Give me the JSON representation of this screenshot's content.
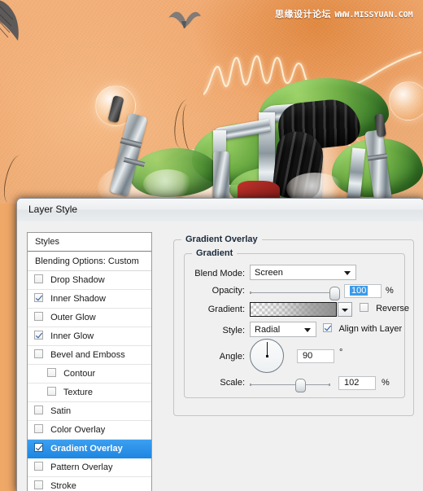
{
  "artwork": {
    "watermark_cn": "思缘设计论坛",
    "watermark_url": "WWW.MISSYUAN.COM",
    "background_color": "#f0a868"
  },
  "dialog": {
    "title": "Layer Style",
    "accent_color": "#1f87e2",
    "styles_list": [
      {
        "label": "Styles",
        "type": "header",
        "checkbox": false,
        "checked": false,
        "selected": false,
        "indent": false
      },
      {
        "label": "Blending Options: Custom",
        "type": "header2",
        "checkbox": false,
        "checked": false,
        "selected": false,
        "indent": false
      },
      {
        "label": "Drop Shadow",
        "type": "item",
        "checkbox": true,
        "checked": false,
        "selected": false,
        "indent": false
      },
      {
        "label": "Inner Shadow",
        "type": "item",
        "checkbox": true,
        "checked": true,
        "selected": false,
        "indent": false
      },
      {
        "label": "Outer Glow",
        "type": "item",
        "checkbox": true,
        "checked": false,
        "selected": false,
        "indent": false
      },
      {
        "label": "Inner Glow",
        "type": "item",
        "checkbox": true,
        "checked": true,
        "selected": false,
        "indent": false
      },
      {
        "label": "Bevel and Emboss",
        "type": "item",
        "checkbox": true,
        "checked": false,
        "selected": false,
        "indent": false
      },
      {
        "label": "Contour",
        "type": "item",
        "checkbox": true,
        "checked": false,
        "selected": false,
        "indent": true
      },
      {
        "label": "Texture",
        "type": "item",
        "checkbox": true,
        "checked": false,
        "selected": false,
        "indent": true
      },
      {
        "label": "Satin",
        "type": "item",
        "checkbox": true,
        "checked": false,
        "selected": false,
        "indent": false
      },
      {
        "label": "Color Overlay",
        "type": "item",
        "checkbox": true,
        "checked": false,
        "selected": false,
        "indent": false
      },
      {
        "label": "Gradient Overlay",
        "type": "item",
        "checkbox": true,
        "checked": true,
        "selected": true,
        "indent": false
      },
      {
        "label": "Pattern Overlay",
        "type": "item",
        "checkbox": true,
        "checked": false,
        "selected": false,
        "indent": false
      },
      {
        "label": "Stroke",
        "type": "item",
        "checkbox": true,
        "checked": false,
        "selected": false,
        "indent": false
      }
    ],
    "panel": {
      "outer_legend": "Gradient Overlay",
      "inner_legend": "Gradient",
      "blend_mode_label": "Blend Mode:",
      "blend_mode_value": "Screen",
      "opacity_label": "Opacity:",
      "opacity_value": "100",
      "opacity_unit": "%",
      "gradient_label": "Gradient:",
      "reverse_label": "Reverse",
      "reverse_checked": false,
      "style_label": "Style:",
      "style_value": "Radial",
      "align_label": "Align with Layer",
      "align_checked": true,
      "angle_label": "Angle:",
      "angle_value": "90",
      "angle_unit": "°",
      "scale_label": "Scale:",
      "scale_value": "102",
      "scale_unit": "%"
    }
  }
}
